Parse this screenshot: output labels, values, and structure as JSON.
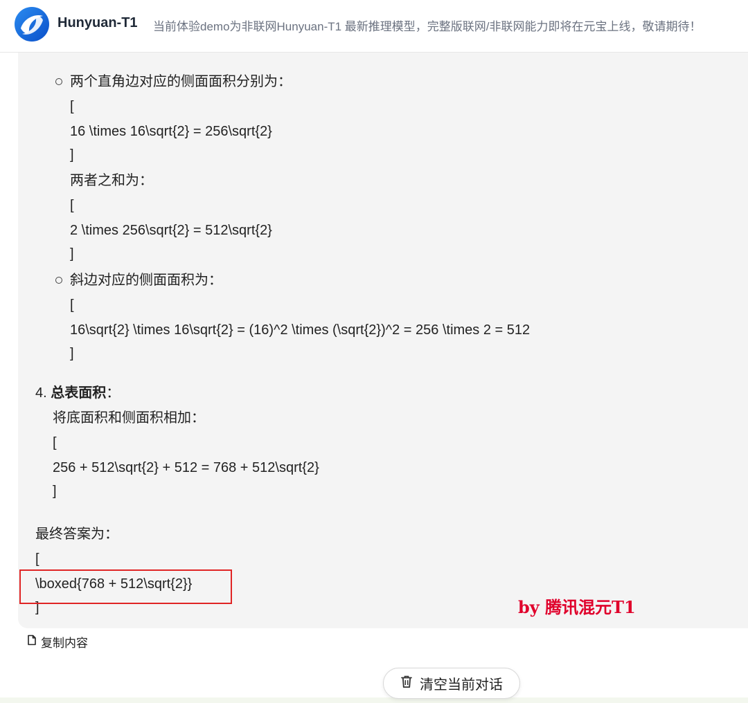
{
  "header": {
    "app_name": "Hunyuan-T1",
    "notice": "当前体验demo为非联网Hunyuan-T1 最新推理模型，完整版联网/非联网能力即将在元宝上线，敬请期待！"
  },
  "content": {
    "bullet1_title": "两个直角边对应的侧面面积分别为：",
    "b1_open": "[",
    "b1_formula": "16 \\times 16\\sqrt{2} = 256\\sqrt{2}",
    "b1_close": "]",
    "sum_label": "两者之和为：",
    "sum_open": "[",
    "sum_formula": "2 \\times 256\\sqrt{2} = 512\\sqrt{2}",
    "sum_close": "]",
    "bullet2_title": "斜边对应的侧面面积为：",
    "b2_open": "[",
    "b2_formula": "16\\sqrt{2} \\times 16\\sqrt{2} = (16)^2 \\times (\\sqrt{2})^2 = 256 \\times 2 = 512",
    "b2_close": "]",
    "step4_number": "4.",
    "step4_title": "总表面积",
    "step4_colon": "：",
    "step4_desc": "将底面积和侧面积相加：",
    "s4_open": "[",
    "s4_formula": "256 + 512\\sqrt{2} + 512 = 768 + 512\\sqrt{2}",
    "s4_close": "]",
    "final_label": "最终答案为：",
    "final_open": "[",
    "final_formula": "\\boxed{768 + 512\\sqrt{2}}",
    "final_close": "]"
  },
  "signature": "by 腾讯混元T1",
  "actions": {
    "copy_label": "复制内容",
    "clear_label": "清空当前对话"
  },
  "colors": {
    "accent_red": "#e02424",
    "signature_red": "#e0002b",
    "logo_blue": "#1a73e8"
  },
  "icons": {
    "logo": "hunyuan-logo",
    "copy": "copy-icon",
    "trash": "trash-icon"
  }
}
